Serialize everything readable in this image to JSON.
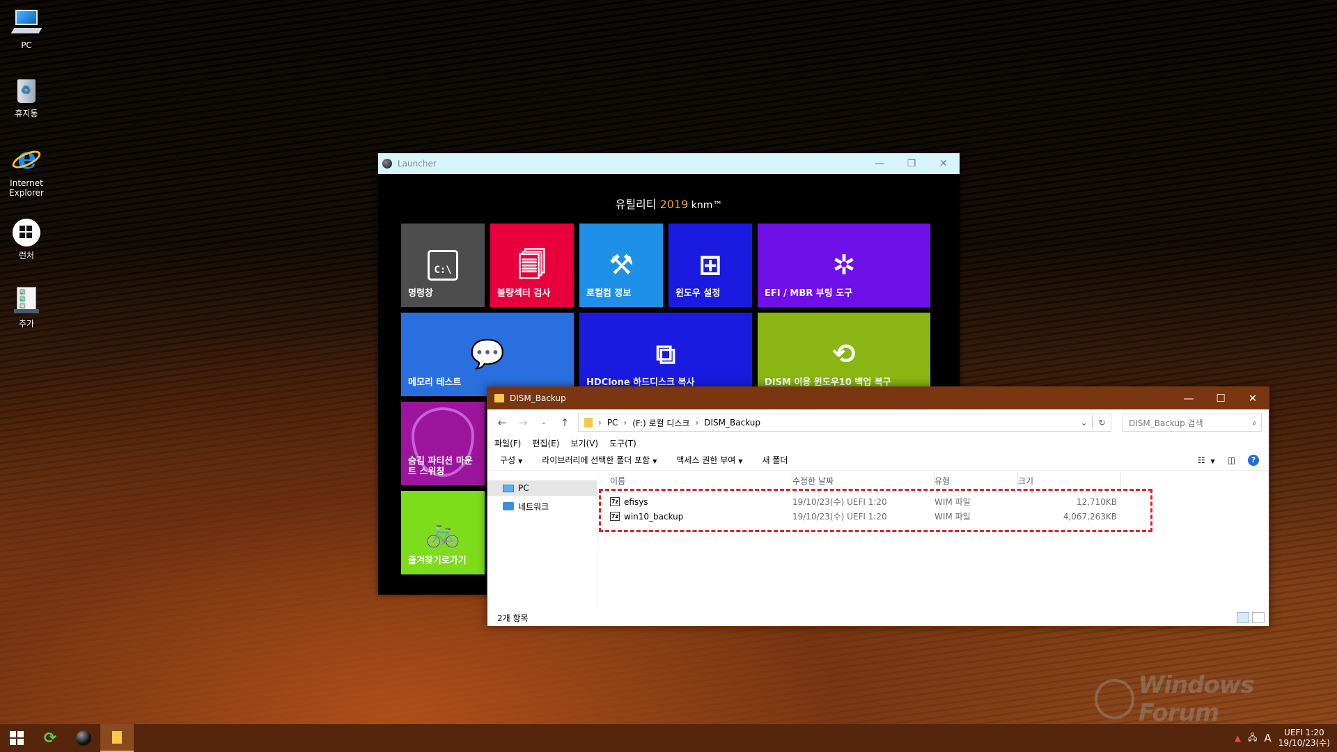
{
  "desktop": {
    "icons": [
      {
        "label": "PC"
      },
      {
        "label": "휴지통"
      },
      {
        "label": "Internet\nExplorer"
      },
      {
        "label": "런처"
      },
      {
        "label": "추가"
      }
    ]
  },
  "launcher": {
    "title": "Launcher",
    "heading_prefix": "유틸리티 ",
    "heading_year": "2019",
    "heading_suffix": " knm™",
    "tiles": [
      {
        "label": "명령창",
        "color": "#4d4d4d",
        "icon": "cmd-icon"
      },
      {
        "label": "불량섹터 검사",
        "color": "#e8003d",
        "icon": "documents-icon"
      },
      {
        "label": "로컬컴 정보",
        "color": "#1e90e8",
        "icon": "tools-icon"
      },
      {
        "label": "윈도우 설정",
        "color": "#1a1ae0",
        "icon": "windows-search-icon"
      },
      {
        "label": "EFI / MBR 부팅 도구",
        "color": "#7010e8",
        "icon": "wrench-sparkle-icon"
      },
      {
        "label": "메모리 테스트",
        "color": "#2a6fe0",
        "icon": "chat-bubbles-icon"
      },
      {
        "label": "HDClone 하드디스크 복사",
        "color": "#1a1ae0",
        "icon": "clone-icon"
      },
      {
        "label": "DISM 이용 윈도우10 백업 복구",
        "color": "#8ab512",
        "icon": "restore-drive-icon"
      },
      {
        "label": "숨김 파티션 마운트 스위칭",
        "color": "#9c159c",
        "icon": "guitar-pick-icon"
      },
      {
        "label": "즐겨찾기로가기",
        "color": "#7ddc1c",
        "icon": "bicycle-icon"
      }
    ]
  },
  "explorer": {
    "title": "DISM_Backup",
    "breadcrumb": [
      "PC",
      "(F:) 로컬 디스크",
      "DISM_Backup"
    ],
    "search_placeholder": "DISM_Backup 검색",
    "menu": [
      "파일(F)",
      "편집(E)",
      "보기(V)",
      "도구(T)"
    ],
    "commands": [
      "구성",
      "라이브러리에 선택한 폴더 포함",
      "액세스 권한 부여",
      "새 폴더"
    ],
    "nav": [
      "PC",
      "네트워크"
    ],
    "columns": [
      "이름",
      "수정한 날짜",
      "유형",
      "크기"
    ],
    "files": [
      {
        "name": "efisys",
        "date": "19/10/23(수) UEFI  1:20",
        "type": "WIM 파일",
        "size": "12,710KB"
      },
      {
        "name": "win10_backup",
        "date": "19/10/23(수) UEFI  1:20",
        "type": "WIM 파일",
        "size": "4,067,263KB"
      }
    ],
    "status": "2개 항목",
    "highlight_color": "#e0232b"
  },
  "watermark": {
    "text": "Windows Forum"
  },
  "taskbar": {
    "tray_lang": "A",
    "clock_time": "UEFI  1:20",
    "clock_date": "19/10/23(수)"
  }
}
